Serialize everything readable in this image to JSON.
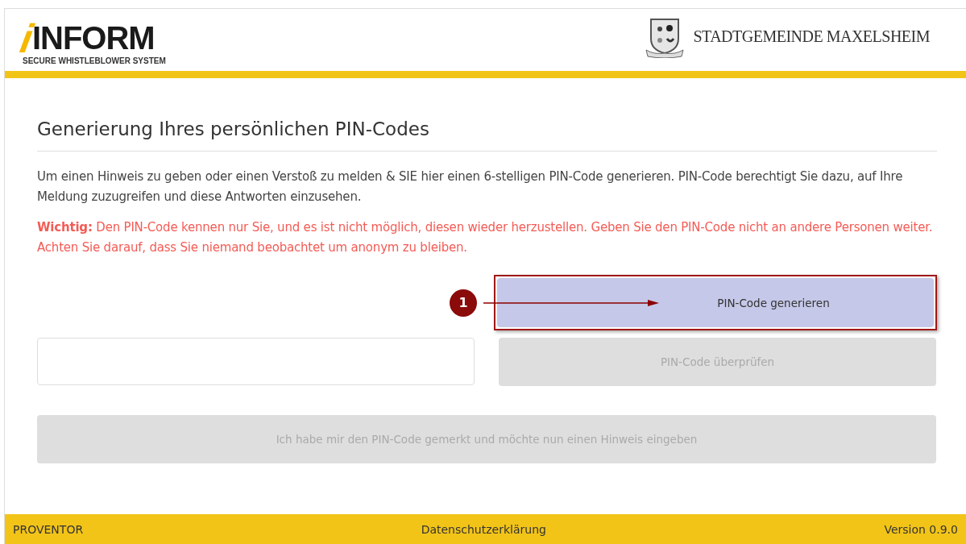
{
  "header": {
    "logo": {
      "mark": "i",
      "name": "INFORM",
      "tagline": "SECURE WHISTLEBLOWER SYSTEM"
    },
    "municipality": "STADTGEMEINDE MAXELSHEIM"
  },
  "title": "Generierung Ihres persönlichen PIN-Codes",
  "intro": "Um einen Hinweis zu geben oder einen Verstoß zu melden & SIE hier einen 6-stelligen PIN-Code generieren. PIN-Code berechtigt Sie dazu, auf Ihre Meldung zuzugreifen und diese Antworten einzusehen.",
  "warning": "**Wichtig:** Den PIN-Code kennen nur Sie, und es ist nicht möglich, diesen wieder herzustellen. Geben Sie den PIN-Code nicht an andere Personen weiter. Achten Sie darauf, dass Sie niemand beobachtet um anonym zu bleiben.",
  "generate_button": {
    "label": "PIN-Code generieren",
    "disabled": false,
    "highlighted": true
  },
  "callout": {
    "number": "1"
  },
  "verify_button": {
    "label": "PIN-Code überprüfen",
    "disabled": true
  },
  "continue_button": {
    "label": "Ich habe mir den PIN-Code gemerkt und möchte nun einen Hinweis eingeben",
    "disabled": true
  },
  "footer": {
    "left": "PROVENTOR",
    "center": "Datenschutzerklärung",
    "right": "Version 0.9.0"
  }
}
